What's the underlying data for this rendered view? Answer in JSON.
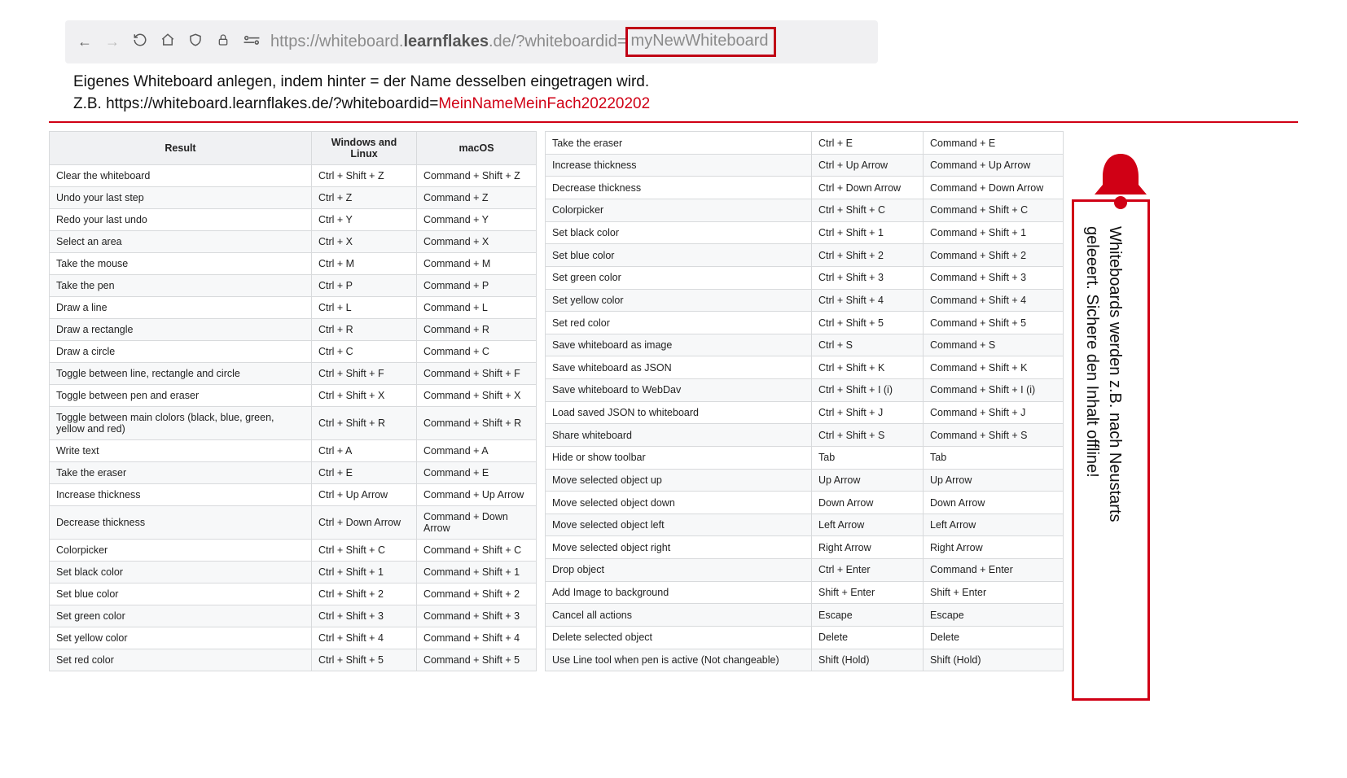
{
  "url": {
    "prefix": "https://whiteboard.",
    "domain_bold": "learnflakes",
    "domain_suffix": ".de",
    "path": "/?whiteboardid=",
    "highlight": "myNewWhiteboard"
  },
  "instructions": {
    "line1": "Eigenes Whiteboard anlegen, indem hinter = der Name desselben eingetragen wird.",
    "line2_prefix": "Z.B. https://whiteboard.learnflakes.de/?whiteboardid=",
    "line2_red": "MeinNameMeinFach20220202"
  },
  "table": {
    "headers": {
      "result": "Result",
      "win": "Windows and Linux",
      "mac": "macOS"
    },
    "left_rows": [
      {
        "r": "Clear the whiteboard",
        "w": "Ctrl + Shift + Z",
        "m": "Command + Shift + Z"
      },
      {
        "r": "Undo your last step",
        "w": "Ctrl + Z",
        "m": "Command + Z"
      },
      {
        "r": "Redo your last undo",
        "w": "Ctrl + Y",
        "m": "Command + Y"
      },
      {
        "r": "Select an area",
        "w": "Ctrl + X",
        "m": "Command + X"
      },
      {
        "r": "Take the mouse",
        "w": "Ctrl + M",
        "m": "Command + M"
      },
      {
        "r": "Take the pen",
        "w": "Ctrl + P",
        "m": "Command + P"
      },
      {
        "r": "Draw a line",
        "w": "Ctrl + L",
        "m": "Command + L"
      },
      {
        "r": "Draw a rectangle",
        "w": "Ctrl + R",
        "m": "Command + R"
      },
      {
        "r": "Draw a circle",
        "w": "Ctrl + C",
        "m": "Command + C"
      },
      {
        "r": "Toggle between line, rectangle and circle",
        "w": "Ctrl + Shift + F",
        "m": "Command + Shift + F"
      },
      {
        "r": "Toggle between pen and eraser",
        "w": "Ctrl + Shift + X",
        "m": "Command + Shift + X"
      },
      {
        "r": "Toggle between main clolors (black, blue, green, yellow and red)",
        "w": "Ctrl + Shift + R",
        "m": "Command + Shift + R"
      },
      {
        "r": "Write text",
        "w": "Ctrl + A",
        "m": "Command + A"
      },
      {
        "r": "Take the eraser",
        "w": "Ctrl + E",
        "m": "Command + E"
      },
      {
        "r": "Increase thickness",
        "w": "Ctrl + Up Arrow",
        "m": "Command + Up Arrow"
      },
      {
        "r": "Decrease thickness",
        "w": "Ctrl + Down Arrow",
        "m": "Command + Down Arrow"
      },
      {
        "r": "Colorpicker",
        "w": "Ctrl + Shift + C",
        "m": "Command + Shift + C"
      },
      {
        "r": "Set black color",
        "w": "Ctrl + Shift + 1",
        "m": "Command + Shift + 1"
      },
      {
        "r": "Set blue color",
        "w": "Ctrl + Shift + 2",
        "m": "Command + Shift + 2"
      },
      {
        "r": "Set green color",
        "w": "Ctrl + Shift + 3",
        "m": "Command + Shift + 3"
      },
      {
        "r": "Set yellow color",
        "w": "Ctrl + Shift + 4",
        "m": "Command + Shift + 4"
      },
      {
        "r": "Set red color",
        "w": "Ctrl + Shift + 5",
        "m": "Command + Shift + 5"
      }
    ],
    "right_rows": [
      {
        "r": "Take the eraser",
        "w": "Ctrl + E",
        "m": "Command + E"
      },
      {
        "r": "Increase thickness",
        "w": "Ctrl + Up Arrow",
        "m": "Command + Up Arrow"
      },
      {
        "r": "Decrease thickness",
        "w": "Ctrl + Down Arrow",
        "m": "Command + Down Arrow"
      },
      {
        "r": "Colorpicker",
        "w": "Ctrl + Shift + C",
        "m": "Command + Shift + C"
      },
      {
        "r": "Set black color",
        "w": "Ctrl + Shift + 1",
        "m": "Command + Shift + 1"
      },
      {
        "r": "Set blue color",
        "w": "Ctrl + Shift + 2",
        "m": "Command + Shift + 2"
      },
      {
        "r": "Set green color",
        "w": "Ctrl + Shift + 3",
        "m": "Command + Shift + 3"
      },
      {
        "r": "Set yellow color",
        "w": "Ctrl + Shift + 4",
        "m": "Command + Shift + 4"
      },
      {
        "r": "Set red color",
        "w": "Ctrl + Shift + 5",
        "m": "Command + Shift + 5"
      },
      {
        "r": "Save whiteboard as image",
        "w": "Ctrl + S",
        "m": "Command + S"
      },
      {
        "r": "Save whiteboard as JSON",
        "w": "Ctrl + Shift + K",
        "m": "Command + Shift + K"
      },
      {
        "r": "Save whiteboard to WebDav",
        "w": "Ctrl + Shift + I (i)",
        "m": "Command + Shift + I (i)"
      },
      {
        "r": "Load saved JSON to whiteboard",
        "w": "Ctrl + Shift + J",
        "m": "Command + Shift + J"
      },
      {
        "r": "Share whiteboard",
        "w": "Ctrl + Shift + S",
        "m": "Command + Shift + S"
      },
      {
        "r": "Hide or show toolbar",
        "w": "Tab",
        "m": "Tab"
      },
      {
        "r": "Move selected object up",
        "w": "Up Arrow",
        "m": "Up Arrow"
      },
      {
        "r": "Move selected object down",
        "w": "Down Arrow",
        "m": "Down Arrow"
      },
      {
        "r": "Move selected object left",
        "w": "Left Arrow",
        "m": "Left Arrow"
      },
      {
        "r": "Move selected object right",
        "w": "Right Arrow",
        "m": "Right Arrow"
      },
      {
        "r": "Drop object",
        "w": "Ctrl + Enter",
        "m": "Command + Enter"
      },
      {
        "r": "Add Image to background",
        "w": "Shift + Enter",
        "m": "Shift + Enter"
      },
      {
        "r": "Cancel all actions",
        "w": "Escape",
        "m": "Escape"
      },
      {
        "r": "Delete selected object",
        "w": "Delete",
        "m": "Delete"
      },
      {
        "r": "Use Line tool when pen is active (Not changeable)",
        "w": "Shift (Hold)",
        "m": "Shift (Hold)"
      }
    ]
  },
  "warning": {
    "line1": "Whiteboards werden z.B. nach Neustarts",
    "line2": "geleeert. Sichere den Inhalt offline!"
  }
}
